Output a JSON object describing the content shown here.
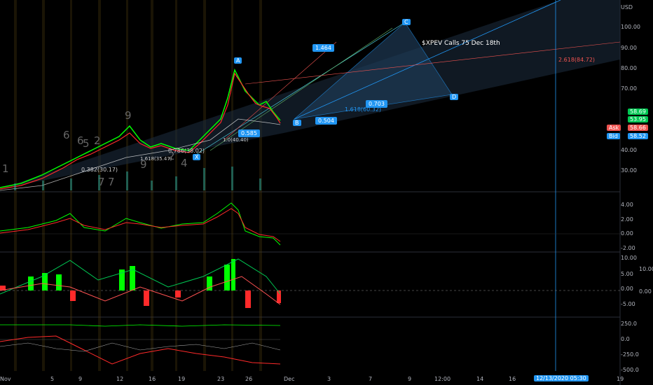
{
  "currency": "USD",
  "annotation": "$XPEV Calls 75 Dec 18th",
  "price_axis": {
    "main": [
      "100.00",
      "90.00",
      "80.00",
      "70.00",
      "40.00",
      "30.00"
    ],
    "osc1": [
      "4.00",
      "2.00",
      "0.00",
      "-2.00"
    ],
    "osc2": [
      "10.00",
      "5.00",
      "0.00",
      "-5.00"
    ],
    "osc2_right": [
      "10.00",
      "0.00"
    ],
    "osc3": [
      "250.0",
      "0.0",
      "-250.0",
      "-500.0"
    ]
  },
  "price_tags": {
    "last": "58.69",
    "second": "53.95",
    "ask_label": "Ask",
    "ask": "58.66",
    "bid_label": "Bid",
    "bid": "58.52"
  },
  "x_axis": [
    "Nov",
    "5",
    "9",
    "12",
    "16",
    "19",
    "23",
    "26",
    "Dec",
    "3",
    "7",
    "9",
    "12:00",
    "14",
    "16",
    "19"
  ],
  "cursor_date": "12/13/2020  05:30",
  "waves": {
    "A": "A",
    "B": "B",
    "C": "C",
    "D": "D",
    "X": "X"
  },
  "ratios": {
    "r1": "1.464",
    "r2": "0.703",
    "r3": "0.504",
    "r4": "0.585"
  },
  "fib_labels": {
    "ext": "2.618(84.72)",
    "mid": "1.618(60.32)",
    "low": "0.382(30.17)",
    "low2": "0.786(38.02)",
    "low3": "1.0(40.40)",
    "low4": "1.618(35.47)"
  },
  "elliott_counts": [
    "1",
    "6",
    "6",
    "5",
    "2",
    "9",
    "9",
    "2",
    "4",
    "7",
    "7"
  ],
  "colors": {
    "up": "#26a69a",
    "bright_up": "#00ff00",
    "down": "#ff2a2a",
    "blue": "#2196f3",
    "grid": "#1e222d"
  }
}
